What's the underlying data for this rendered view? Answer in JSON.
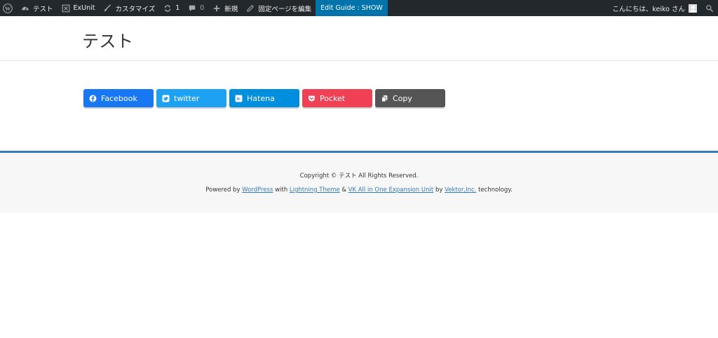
{
  "adminbar": {
    "site_name": "テスト",
    "exunit": "ExUnit",
    "customize": "カスタマイズ",
    "updates_count": "1",
    "comments_count": "0",
    "new": "新規",
    "edit_page": "固定ページを編集",
    "edit_guide": "Edit Guide : SHOW",
    "greeting": "こんにちは、keiko さん"
  },
  "header": {
    "title": "テスト"
  },
  "share_buttons": [
    {
      "label": "Facebook",
      "icon": "facebook-icon",
      "color": "#1877f2"
    },
    {
      "label": "twitter",
      "icon": "twitter-icon",
      "color": "#1da1f2"
    },
    {
      "label": "Hatena",
      "icon": "hatena-icon",
      "color": "#008fde"
    },
    {
      "label": "Pocket",
      "icon": "pocket-icon",
      "color": "#ef4056"
    },
    {
      "label": "Copy",
      "icon": "copy-icon",
      "color": "#555555"
    }
  ],
  "footer": {
    "copyright": "Copyright © テスト All Rights Reserved.",
    "powered_by": "Powered by",
    "wordpress_link": "WordPress",
    "with": "with",
    "lightning_link": "Lightning Theme",
    "amp": "&",
    "vk_link": "VK All in One Expansion Unit",
    "by": "by",
    "vektor_link": "Vektor,Inc.",
    "technology": "technology."
  },
  "colors": {
    "adminbar_bg": "#23282d",
    "guide_bg": "#0073aa",
    "footer_border": "#337ab7",
    "link": "#337ab7"
  }
}
